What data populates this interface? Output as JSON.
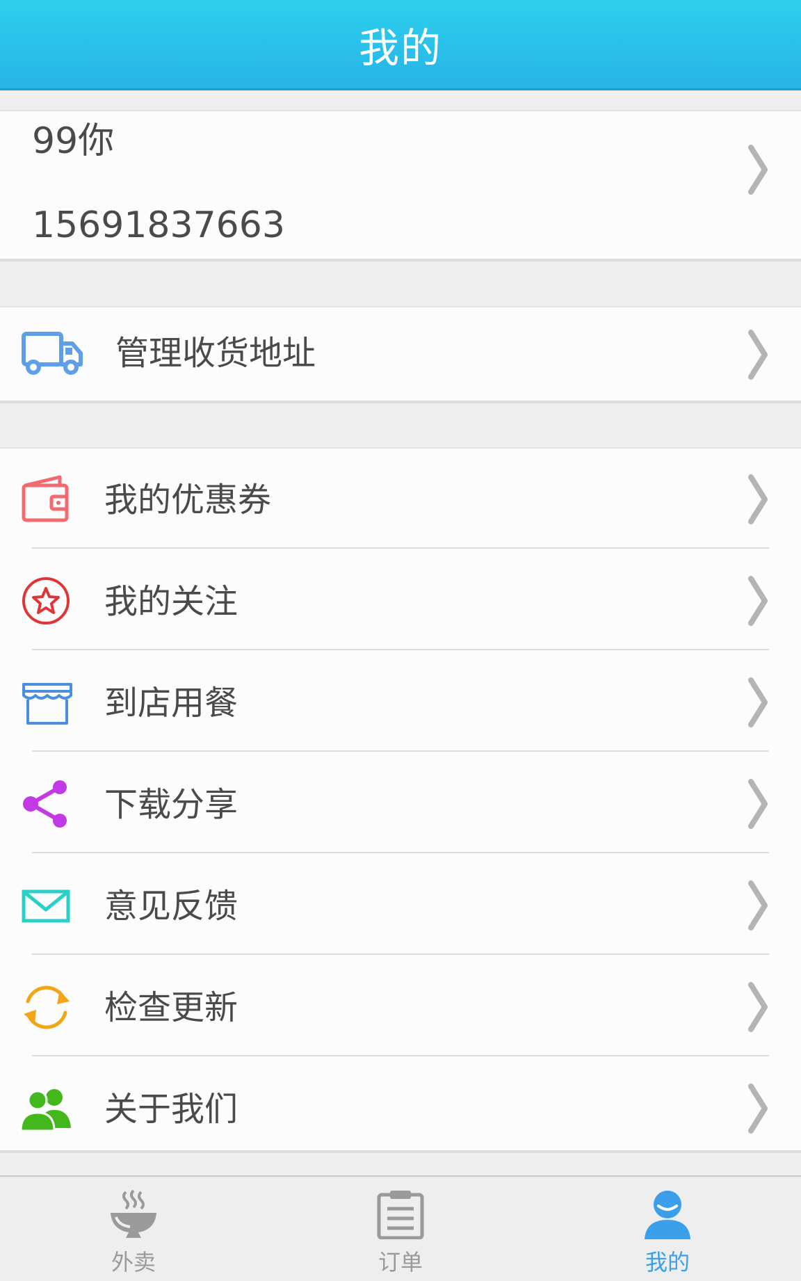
{
  "header": {
    "title": "我的"
  },
  "profile": {
    "name": "99你",
    "phone": "15691837663"
  },
  "address": {
    "label": "管理收货地址",
    "icon": "truck-icon"
  },
  "menu": {
    "items": [
      {
        "label": "我的优惠券",
        "icon": "wallet-icon"
      },
      {
        "label": "我的关注",
        "icon": "star-circle-icon"
      },
      {
        "label": "到店用餐",
        "icon": "store-icon"
      },
      {
        "label": "下载分享",
        "icon": "share-icon"
      },
      {
        "label": "意见反馈",
        "icon": "mail-icon"
      },
      {
        "label": "检查更新",
        "icon": "refresh-icon"
      },
      {
        "label": "关于我们",
        "icon": "users-icon"
      }
    ]
  },
  "tabbar": {
    "tabs": [
      {
        "label": "外卖",
        "icon": "bowl-icon",
        "active": false
      },
      {
        "label": "订单",
        "icon": "clipboard-icon",
        "active": false
      },
      {
        "label": "我的",
        "icon": "user-icon",
        "active": true
      }
    ]
  },
  "colors": {
    "header": "#2ac3ec",
    "tab_active": "#3b9fea",
    "tab_inactive": "#9a9a9a",
    "truck": "#5e9fe8",
    "wallet": "#f06a6e",
    "star": "#e03437",
    "store": "#4a8fe0",
    "share": "#c23ae6",
    "mail": "#2ad0c6",
    "refresh": "#f3a516",
    "users": "#43b81c"
  }
}
